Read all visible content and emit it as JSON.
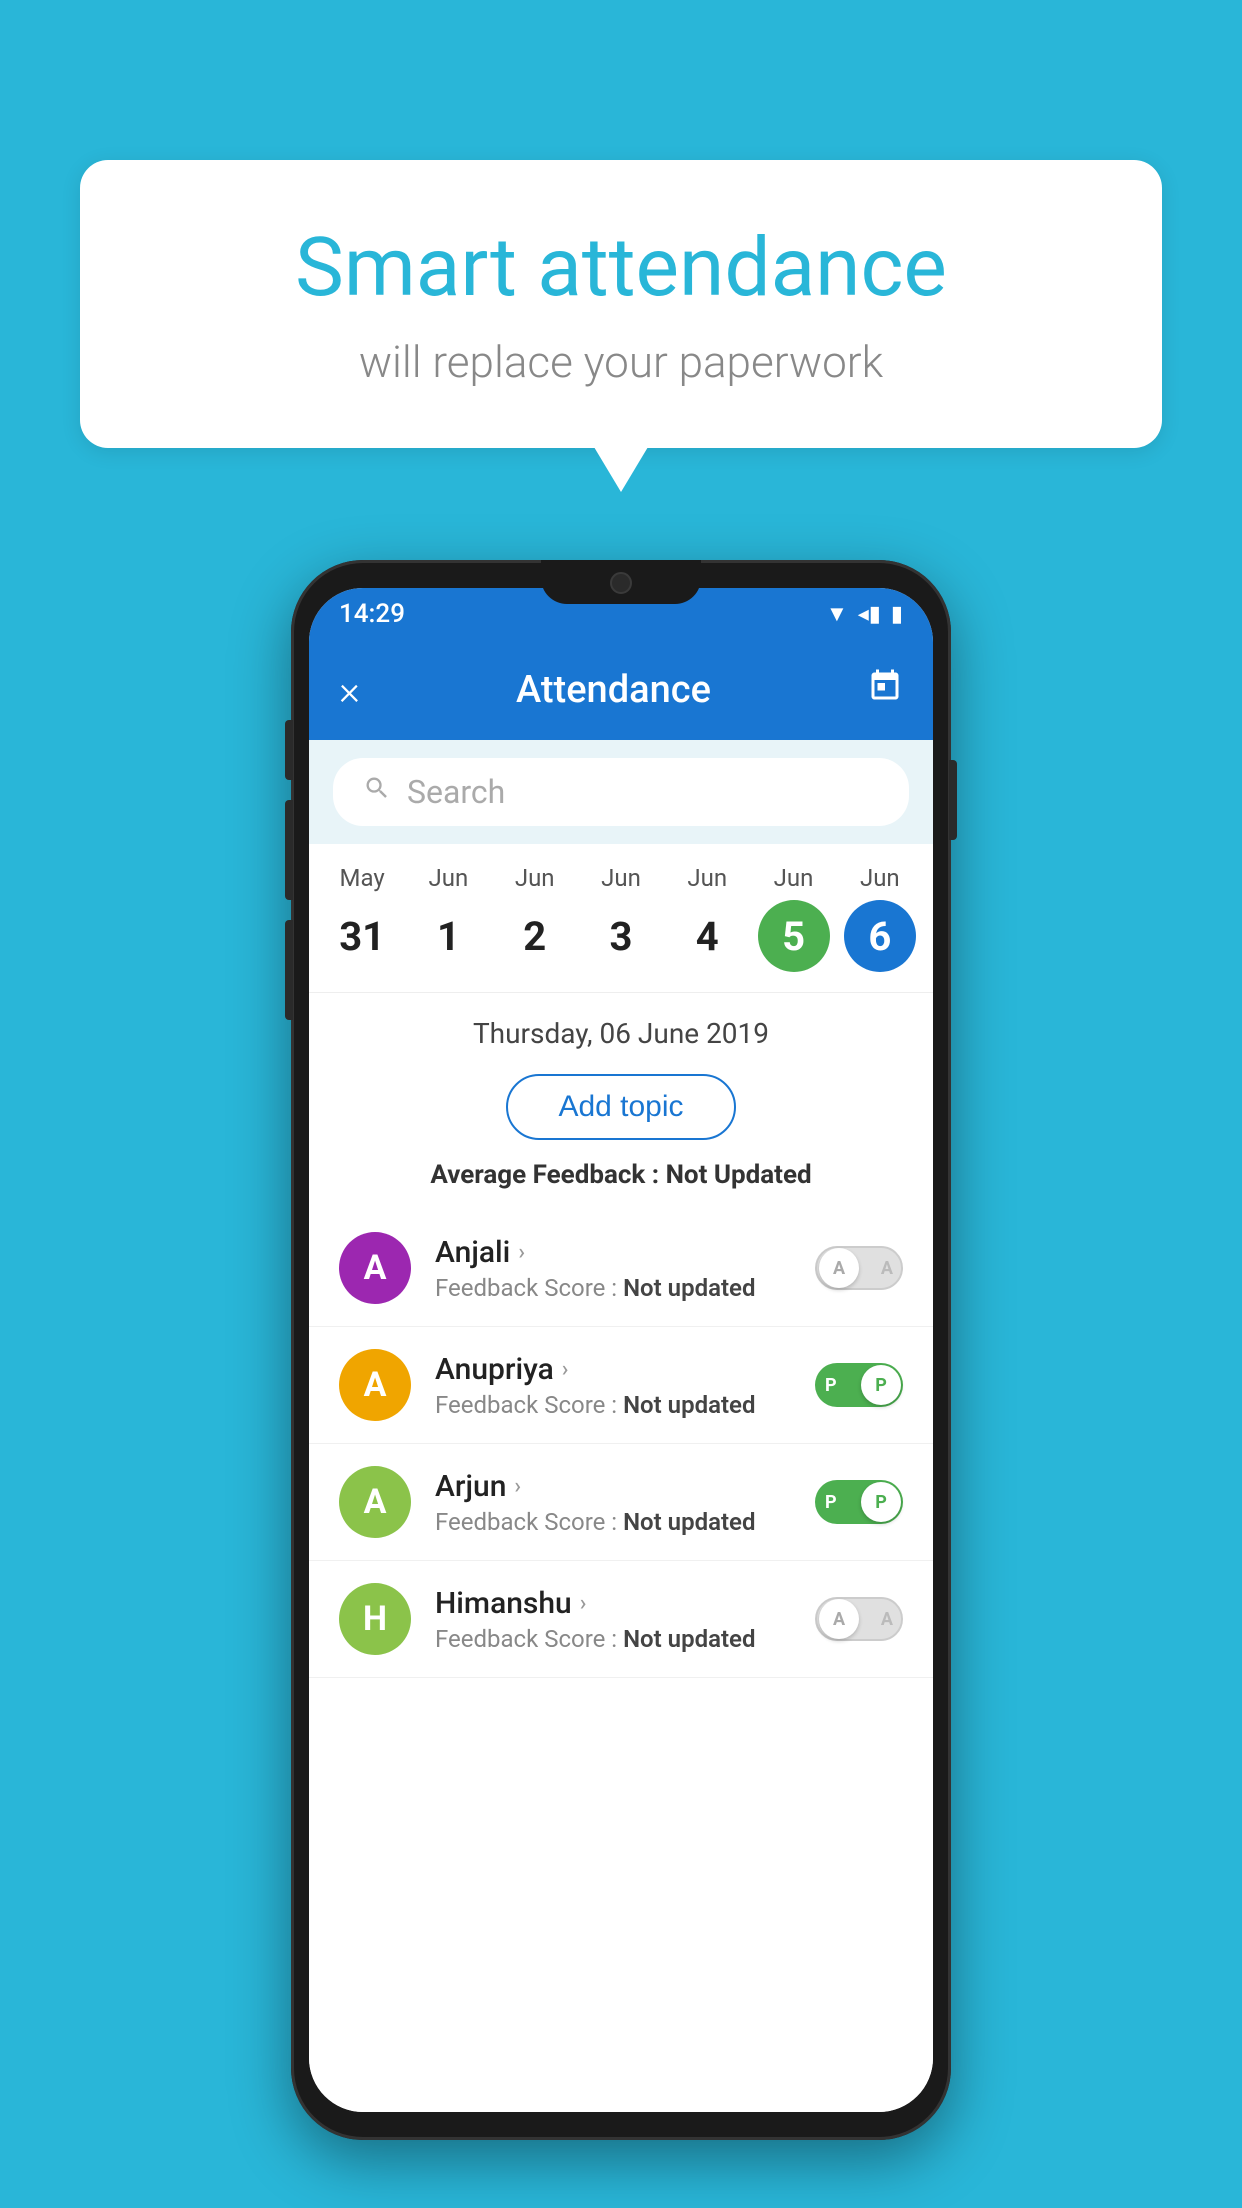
{
  "background_color": "#29b6d8",
  "speech_bubble": {
    "title": "Smart attendance",
    "subtitle": "will replace your paperwork"
  },
  "phone": {
    "status_bar": {
      "time": "14:29",
      "icons": [
        "wifi",
        "signal",
        "battery"
      ]
    },
    "app_bar": {
      "close_label": "×",
      "title": "Attendance",
      "calendar_icon": "📅"
    },
    "search": {
      "placeholder": "Search"
    },
    "calendar": {
      "days": [
        {
          "month": "May",
          "date": "31",
          "state": "normal"
        },
        {
          "month": "Jun",
          "date": "1",
          "state": "normal"
        },
        {
          "month": "Jun",
          "date": "2",
          "state": "normal"
        },
        {
          "month": "Jun",
          "date": "3",
          "state": "normal"
        },
        {
          "month": "Jun",
          "date": "4",
          "state": "normal"
        },
        {
          "month": "Jun",
          "date": "5",
          "state": "today"
        },
        {
          "month": "Jun",
          "date": "6",
          "state": "selected"
        }
      ]
    },
    "selected_date": "Thursday, 06 June 2019",
    "add_topic_label": "Add topic",
    "avg_feedback_label": "Average Feedback : ",
    "avg_feedback_value": "Not Updated",
    "students": [
      {
        "name": "Anjali",
        "initial": "A",
        "avatar_color": "#9c27b0",
        "feedback_label": "Feedback Score : ",
        "feedback_value": "Not updated",
        "attendance": "absent",
        "toggle_letter": "A"
      },
      {
        "name": "Anupriya",
        "initial": "A",
        "avatar_color": "#f0a500",
        "feedback_label": "Feedback Score : ",
        "feedback_value": "Not updated",
        "attendance": "present",
        "toggle_letter": "P"
      },
      {
        "name": "Arjun",
        "initial": "A",
        "avatar_color": "#8bc34a",
        "feedback_label": "Feedback Score : ",
        "feedback_value": "Not updated",
        "attendance": "present",
        "toggle_letter": "P"
      },
      {
        "name": "Himanshu",
        "initial": "H",
        "avatar_color": "#8bc34a",
        "feedback_label": "Feedback Score : ",
        "feedback_value": "Not updated",
        "attendance": "absent",
        "toggle_letter": "A"
      }
    ]
  }
}
